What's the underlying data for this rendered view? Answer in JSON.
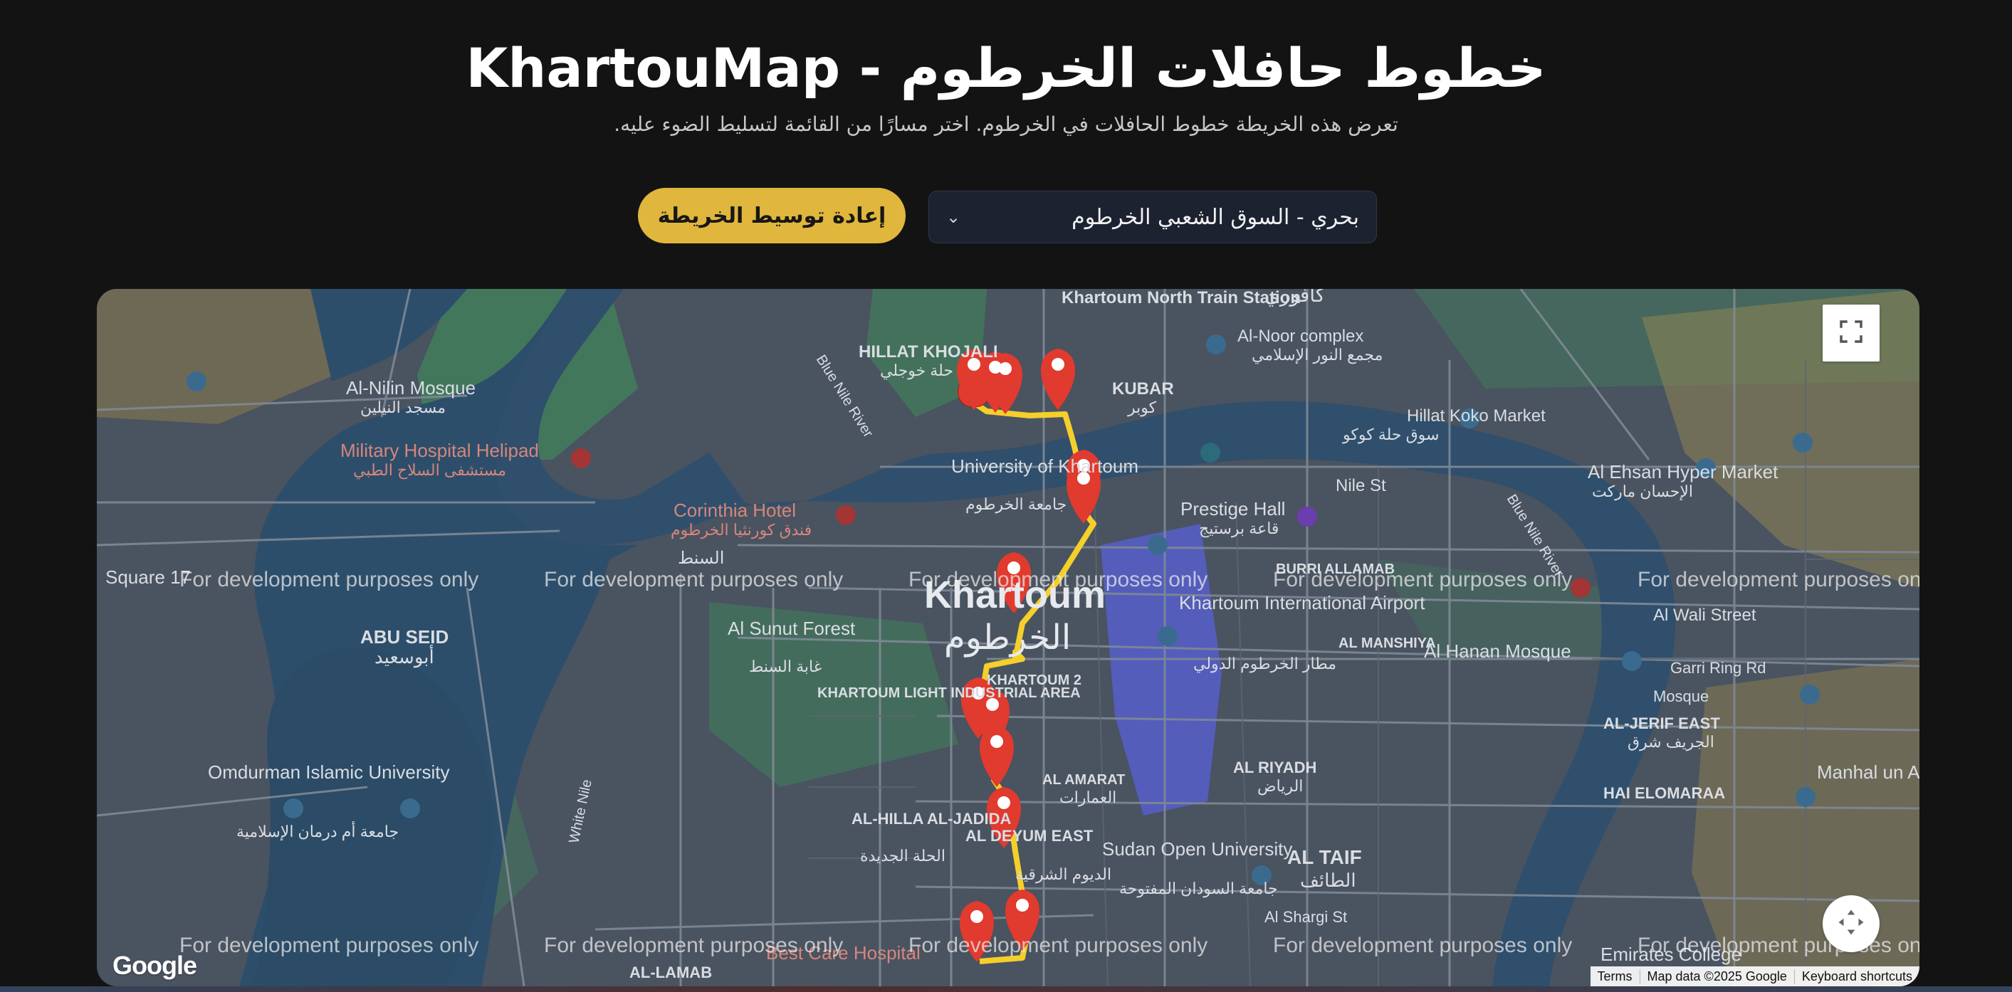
{
  "header": {
    "title": "خطوط حافلات الخرطوم - KhartouMap",
    "subtitle": "تعرض هذه الخريطة خطوط الحافلات في الخرطوم. اختر مسارًا من القائمة لتسليط الضوء عليه."
  },
  "controls": {
    "recenter_label": "إعادة توسيط الخريطة",
    "selected_route": "بحري - السوق الشعبي الخرطوم"
  },
  "map": {
    "watermark": "For development purposes only",
    "logo": "Google",
    "footer": {
      "terms": "Terms",
      "map_data": "Map data ©2025 Google",
      "shortcuts": "Keyboard shortcuts"
    },
    "labels": {
      "khartoum_north_train_station": "Khartoum North Train Station",
      "kafori": "كافوري",
      "al_noor_complex": "Al-Noor complex",
      "al_noor_complex_ar": "مجمع النور الإسلامي",
      "hillat_khojali": "HILLAT KHOJALI",
      "hillat_khojali_ar": "حلة خوجلي",
      "kubar": "KUBAR",
      "kubar_ar": "كوبر",
      "hillat_koko_market": "Hillat Koko Market",
      "hillat_koko_market_ar": "سوق حلة كوكو",
      "blue_nile_river": "Blue Nile River",
      "al_nilin_mosque": "Al-Nilin Mosque",
      "al_nilin_mosque_ar": "مسجد النيلين",
      "military_hospital_helipad": "Military Hospital Helipad",
      "military_hospital_ar": "مستشفى السلاح الطبي",
      "university_of_khartoum": "University of Khartoum",
      "university_of_khartoum_ar": "جامعة الخرطوم",
      "prestige_hall": "Prestige Hall",
      "prestige_hall_ar": "قاعة برستيج",
      "nile_st": "Nile St",
      "al_ehsan_hyper_market": "Al Ehsan Hyper Market",
      "al_ehsan_ar": "الإحسان ماركت",
      "corinthia_hotel": "Corinthia Hotel",
      "corinthia_hotel_ar": "فندق كورنثيا الخرطوم",
      "al_mogran": "السنط",
      "khartoum": "Khartoum",
      "khartoum_ar": "الخرطوم",
      "burri_allamab": "BURRI ALLAMAB",
      "al_sunut_forest": "Al Sunut Forest",
      "al_sunut_forest_ar": "غابة السنط",
      "khartoum_international_airport": "Khartoum International Airport",
      "khartoum_airport_ar": "مطار الخرطوم الدولي",
      "al_manshiya": "AL MANSHIYA",
      "al_wali_street": "Al Wali Street",
      "al_hanan_mosque": "Al Hanan Mosque",
      "abu_seid": "ABU SEID",
      "abu_seid_ar": "أبوسعيد",
      "khartoum_light_industrial_area": "KHARTOUM LIGHT INDUSTRIAL AREA",
      "khartoum_2": "KHARTOUM 2",
      "al_jerif_east": "AL-JERIF EAST",
      "al_jerif_east_ar": "الجريف شرق",
      "omdurman_islamic_university": "Omdurman Islamic University",
      "omdurman_islamic_ar": "جامعة أم درمان الإسلامية",
      "white_nile": "White Nile",
      "al_amarat": "AL AMARAT",
      "al_amarat_ar": "العمارات",
      "al_riyadh": "AL RIYADH",
      "al_riyadh_ar": "الرياض",
      "ha_elomaraa": "HAI ELOMARAA",
      "manhal_academy": "Manhal un Academy",
      "al_hilla_al_jadida": "AL-HILLA AL-JADIDA",
      "al_hilla_al_jadida_ar": "الحلة الجديدة",
      "al_deyum_east": "AL DEYUM EAST",
      "al_deyum_east_ar": "الديوم الشرقية",
      "sudan_open_university": "Sudan Open University",
      "sudan_open_ar": "جامعة السودان المفتوحة",
      "al_taif": "AL TAIF",
      "al_taif_ar": "الطائف",
      "al_shargi_st": "Al Shargi St",
      "al_lamab": "AL-LAMAB",
      "best_care_hospital": "Best Care Hospital",
      "emirates_college": "Emirates College",
      "mosque": "Mosque",
      "garri_ring_rd": "Garri Ring Rd",
      "square_17": "Square 17"
    }
  },
  "colors": {
    "background": "#131313",
    "accent": "#e1b63c",
    "route": "#f5cf2a",
    "marker": "#e13a2e",
    "select_bg": "#1c2230"
  },
  "icons": {
    "fullscreen": "fullscreen-icon",
    "compass": "compass-icon",
    "chevron": "chevron-down-icon",
    "marker": "map-marker-icon"
  }
}
